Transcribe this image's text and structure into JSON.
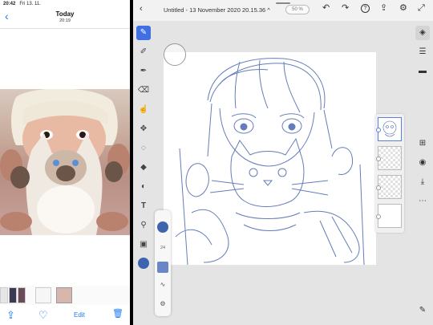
{
  "status_bar": {
    "time": "20:42",
    "date": "Fri 13. 11."
  },
  "photos": {
    "back_glyph": "‹",
    "title": "Today",
    "subtitle": "20:19",
    "bottom_bar": {
      "share_glyph": "⇪",
      "heart_glyph": "♡",
      "edit_label": "Edit",
      "trash_glyph": "🗑"
    }
  },
  "fresco": {
    "top_bar": {
      "back_glyph": "‹",
      "doc_title": "Untitled - 13 November 2020 20.15.36 ^",
      "zoom": "50 %",
      "undo_glyph": "↶",
      "redo_glyph": "↷",
      "help_glyph": "?",
      "export_glyph": "⇪",
      "settings_glyph": "⚙",
      "fullscreen_glyph": "⤢"
    },
    "tools": [
      {
        "name": "pixel-brush",
        "glyph": "✎",
        "active": true
      },
      {
        "name": "live-brush",
        "glyph": "✐"
      },
      {
        "name": "vector-brush",
        "glyph": "✒"
      },
      {
        "name": "eraser",
        "glyph": "⌫"
      },
      {
        "name": "smudge",
        "glyph": "☝"
      },
      {
        "name": "transform",
        "glyph": "✥"
      },
      {
        "name": "lasso",
        "glyph": "◌"
      },
      {
        "name": "fill",
        "glyph": "◆"
      },
      {
        "name": "shape",
        "glyph": "◐"
      },
      {
        "name": "text",
        "glyph": "T"
      },
      {
        "name": "eyedropper",
        "glyph": "⚲"
      },
      {
        "name": "image",
        "glyph": "▣"
      }
    ],
    "current_color": "#3e63b0",
    "brush_panel": {
      "size": "24",
      "wave_glyph": "∿",
      "settings_glyph": "⚙"
    },
    "right_rail": {
      "layers_glyph": "◈",
      "properties_glyph": "☰",
      "comments_glyph": "▬",
      "add_layer_glyph": "⊞",
      "visibility_glyph": "◉",
      "import_glyph": "⤓",
      "more_glyph": "⋯",
      "pen_glyph": "✎"
    }
  }
}
